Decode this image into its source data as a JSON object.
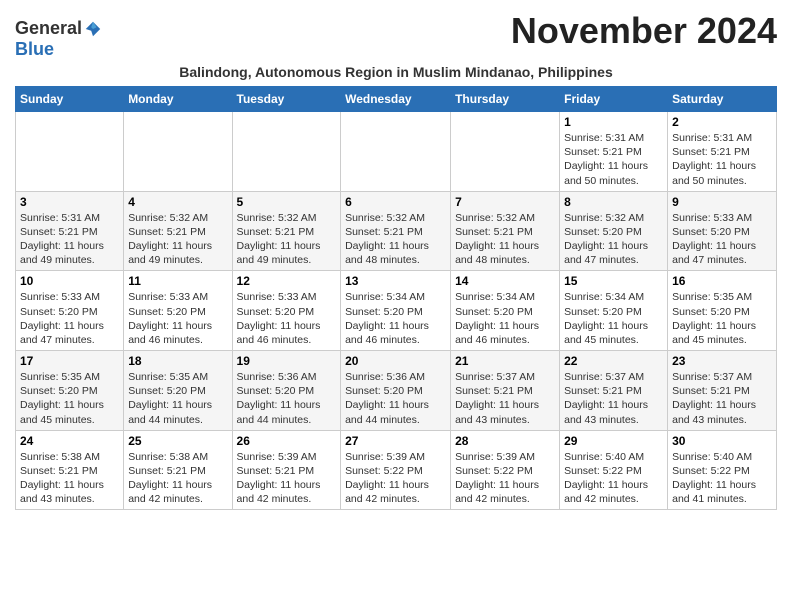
{
  "header": {
    "logo": {
      "general": "General",
      "blue": "Blue"
    },
    "title": "November 2024",
    "subtitle": "Balindong, Autonomous Region in Muslim Mindanao, Philippines"
  },
  "calendar": {
    "days_of_week": [
      "Sunday",
      "Monday",
      "Tuesday",
      "Wednesday",
      "Thursday",
      "Friday",
      "Saturday"
    ],
    "weeks": [
      [
        {
          "day": "",
          "info": ""
        },
        {
          "day": "",
          "info": ""
        },
        {
          "day": "",
          "info": ""
        },
        {
          "day": "",
          "info": ""
        },
        {
          "day": "",
          "info": ""
        },
        {
          "day": "1",
          "info": "Sunrise: 5:31 AM\nSunset: 5:21 PM\nDaylight: 11 hours and 50 minutes."
        },
        {
          "day": "2",
          "info": "Sunrise: 5:31 AM\nSunset: 5:21 PM\nDaylight: 11 hours and 50 minutes."
        }
      ],
      [
        {
          "day": "3",
          "info": "Sunrise: 5:31 AM\nSunset: 5:21 PM\nDaylight: 11 hours and 49 minutes."
        },
        {
          "day": "4",
          "info": "Sunrise: 5:32 AM\nSunset: 5:21 PM\nDaylight: 11 hours and 49 minutes."
        },
        {
          "day": "5",
          "info": "Sunrise: 5:32 AM\nSunset: 5:21 PM\nDaylight: 11 hours and 49 minutes."
        },
        {
          "day": "6",
          "info": "Sunrise: 5:32 AM\nSunset: 5:21 PM\nDaylight: 11 hours and 48 minutes."
        },
        {
          "day": "7",
          "info": "Sunrise: 5:32 AM\nSunset: 5:21 PM\nDaylight: 11 hours and 48 minutes."
        },
        {
          "day": "8",
          "info": "Sunrise: 5:32 AM\nSunset: 5:20 PM\nDaylight: 11 hours and 47 minutes."
        },
        {
          "day": "9",
          "info": "Sunrise: 5:33 AM\nSunset: 5:20 PM\nDaylight: 11 hours and 47 minutes."
        }
      ],
      [
        {
          "day": "10",
          "info": "Sunrise: 5:33 AM\nSunset: 5:20 PM\nDaylight: 11 hours and 47 minutes."
        },
        {
          "day": "11",
          "info": "Sunrise: 5:33 AM\nSunset: 5:20 PM\nDaylight: 11 hours and 46 minutes."
        },
        {
          "day": "12",
          "info": "Sunrise: 5:33 AM\nSunset: 5:20 PM\nDaylight: 11 hours and 46 minutes."
        },
        {
          "day": "13",
          "info": "Sunrise: 5:34 AM\nSunset: 5:20 PM\nDaylight: 11 hours and 46 minutes."
        },
        {
          "day": "14",
          "info": "Sunrise: 5:34 AM\nSunset: 5:20 PM\nDaylight: 11 hours and 46 minutes."
        },
        {
          "day": "15",
          "info": "Sunrise: 5:34 AM\nSunset: 5:20 PM\nDaylight: 11 hours and 45 minutes."
        },
        {
          "day": "16",
          "info": "Sunrise: 5:35 AM\nSunset: 5:20 PM\nDaylight: 11 hours and 45 minutes."
        }
      ],
      [
        {
          "day": "17",
          "info": "Sunrise: 5:35 AM\nSunset: 5:20 PM\nDaylight: 11 hours and 45 minutes."
        },
        {
          "day": "18",
          "info": "Sunrise: 5:35 AM\nSunset: 5:20 PM\nDaylight: 11 hours and 44 minutes."
        },
        {
          "day": "19",
          "info": "Sunrise: 5:36 AM\nSunset: 5:20 PM\nDaylight: 11 hours and 44 minutes."
        },
        {
          "day": "20",
          "info": "Sunrise: 5:36 AM\nSunset: 5:20 PM\nDaylight: 11 hours and 44 minutes."
        },
        {
          "day": "21",
          "info": "Sunrise: 5:37 AM\nSunset: 5:21 PM\nDaylight: 11 hours and 43 minutes."
        },
        {
          "day": "22",
          "info": "Sunrise: 5:37 AM\nSunset: 5:21 PM\nDaylight: 11 hours and 43 minutes."
        },
        {
          "day": "23",
          "info": "Sunrise: 5:37 AM\nSunset: 5:21 PM\nDaylight: 11 hours and 43 minutes."
        }
      ],
      [
        {
          "day": "24",
          "info": "Sunrise: 5:38 AM\nSunset: 5:21 PM\nDaylight: 11 hours and 43 minutes."
        },
        {
          "day": "25",
          "info": "Sunrise: 5:38 AM\nSunset: 5:21 PM\nDaylight: 11 hours and 42 minutes."
        },
        {
          "day": "26",
          "info": "Sunrise: 5:39 AM\nSunset: 5:21 PM\nDaylight: 11 hours and 42 minutes."
        },
        {
          "day": "27",
          "info": "Sunrise: 5:39 AM\nSunset: 5:22 PM\nDaylight: 11 hours and 42 minutes."
        },
        {
          "day": "28",
          "info": "Sunrise: 5:39 AM\nSunset: 5:22 PM\nDaylight: 11 hours and 42 minutes."
        },
        {
          "day": "29",
          "info": "Sunrise: 5:40 AM\nSunset: 5:22 PM\nDaylight: 11 hours and 42 minutes."
        },
        {
          "day": "30",
          "info": "Sunrise: 5:40 AM\nSunset: 5:22 PM\nDaylight: 11 hours and 41 minutes."
        }
      ]
    ]
  }
}
